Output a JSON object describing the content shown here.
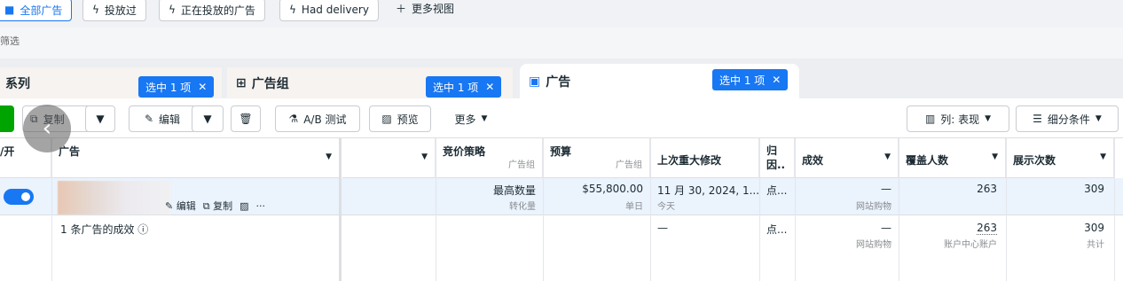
{
  "top_filters": {
    "chips": [
      {
        "label": "全部广告",
        "icon": "folder-icon",
        "active": true
      },
      {
        "label": "投放过",
        "icon": "bolt-icon",
        "active": false
      },
      {
        "label": "正在投放的广告",
        "icon": "bolt-icon",
        "active": false
      },
      {
        "label": "Had delivery",
        "icon": "bolt-icon",
        "active": false
      }
    ],
    "more_views": "更多视图",
    "filter_hint": "筛选"
  },
  "levels": {
    "campaign": {
      "title": "系列",
      "badge": "选中 1 项"
    },
    "adset": {
      "title": "广告组",
      "badge": "选中 1 项"
    },
    "ad": {
      "title": "广告",
      "badge": "选中 1 项"
    }
  },
  "toolbar": {
    "duplicate": "复制",
    "edit": "编辑",
    "ab_test": "A/B 测试",
    "preview": "预览",
    "more": "更多",
    "columns": "列: 表现",
    "breakdown": "细分条件"
  },
  "table": {
    "headers": {
      "toggle": "/开",
      "ad": "广告",
      "bid_strategy": "竞价策略",
      "bid_strategy_sub": "广告组",
      "budget": "预算",
      "budget_sub": "广告组",
      "last_edit": "上次重大修改",
      "attribution": "归因..",
      "results": "成效",
      "reach": "覆盖人数",
      "impressions": "展示次数"
    },
    "row": {
      "actions": {
        "edit": "编辑",
        "duplicate": "复制",
        "more": "···"
      },
      "bid_strategy": "最高数量",
      "bid_strategy_sub": "转化量",
      "budget": "$55,800.00",
      "budget_sub": "单日",
      "last_edit": "11 月 30, 2024, 1...",
      "last_edit_sub": "今天",
      "attribution": "点...",
      "results": "—",
      "results_sub": "网站购物",
      "reach": "263",
      "impressions": "309"
    },
    "summary": {
      "label": "1 条广告的成效",
      "last_edit": "—",
      "attribution": "点...",
      "results": "—",
      "results_sub": "网站购物",
      "reach": "263",
      "reach_sub": "账户中心账户",
      "impressions": "309",
      "impressions_sub": "共计"
    }
  },
  "colors": {
    "accent": "#1877f2",
    "green": "#00a400"
  }
}
